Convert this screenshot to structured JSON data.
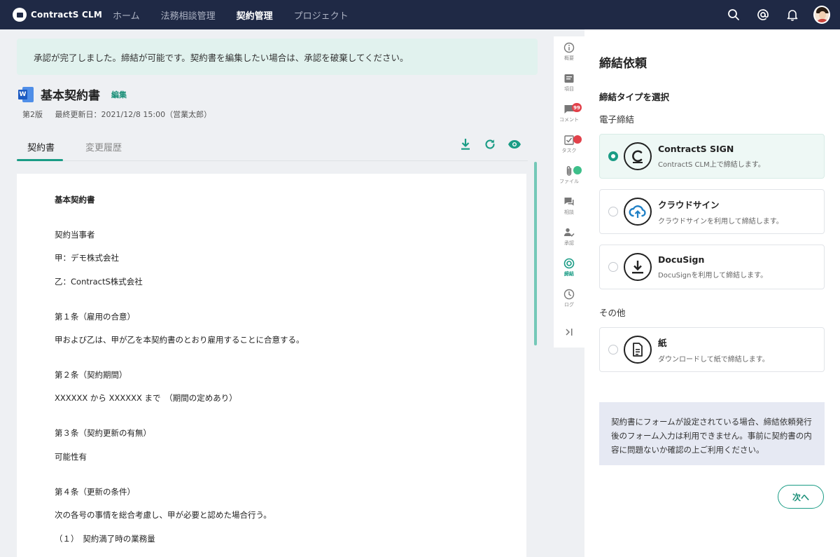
{
  "app": {
    "name": "ContractS CLM"
  },
  "nav": {
    "items": [
      {
        "label": "ホーム",
        "active": false
      },
      {
        "label": "法務相談管理",
        "active": false
      },
      {
        "label": "契約管理",
        "active": true
      },
      {
        "label": "プロジェクト",
        "active": false
      }
    ]
  },
  "alert": {
    "text": "承認が完了しました。締結が可能です。契約書を編集したい場合は、承認を破棄してください。"
  },
  "document": {
    "title": "基本契約書",
    "edit_label": "編集",
    "version": "第2版",
    "updated": "最終更新日：2021/12/8 15:00（営業太郎）",
    "tabs": [
      {
        "label": "契約書",
        "active": true
      },
      {
        "label": "変更履歴",
        "active": false
      }
    ],
    "lines": [
      {
        "text": "基本契約書",
        "bold": true
      },
      {
        "text": "契約当事者",
        "bold": false
      },
      {
        "text": "甲：デモ株式会社",
        "bold": false
      },
      {
        "text": "乙：ContractS株式会社",
        "bold": false
      },
      {
        "text": "第１条（雇用の合意）",
        "bold": false
      },
      {
        "text": "甲および乙は、甲が乙を本契約書のとおり雇用することに合意する。",
        "bold": false
      },
      {
        "text": "第２条（契約期間）",
        "bold": false
      },
      {
        "text": "XXXXXX から XXXXXX まで　（期間の定めあり）",
        "bold": false
      },
      {
        "text": "第３条（契約更新の有無）",
        "bold": false
      },
      {
        "text": "可能性有",
        "bold": false
      },
      {
        "text": "第４条（更新の条件）",
        "bold": false
      },
      {
        "text": "次の各号の事情を総合考慮し、甲が必要と認めた場合行う。",
        "bold": false
      },
      {
        "text": "（１）　契約満了時の業務量",
        "bold": false
      }
    ]
  },
  "rail": {
    "items": [
      {
        "label": "概要",
        "icon": "info-icon"
      },
      {
        "label": "項目",
        "icon": "list-icon"
      },
      {
        "label": "コメント",
        "icon": "comment-icon",
        "badge": "99"
      },
      {
        "label": "タスク",
        "icon": "task-icon",
        "dot_color": "#e2424b"
      },
      {
        "label": "ファイル",
        "icon": "attachment-icon",
        "dot_color": "#3dbf8a"
      },
      {
        "label": "相談",
        "icon": "consult-icon"
      },
      {
        "label": "承認",
        "icon": "approval-icon"
      },
      {
        "label": "締結",
        "icon": "conclude-icon",
        "active": true
      },
      {
        "label": "ログ",
        "icon": "clock-icon"
      },
      {
        "label": "",
        "icon": "collapse-icon"
      }
    ]
  },
  "panel": {
    "title": "締結依頼",
    "section_title": "締結タイプを選択",
    "electronic_label": "電子締結",
    "other_label": "その他",
    "options": [
      {
        "name": "ContractS SIGN",
        "desc": "ContractS CLM上で締結します。",
        "selected": true
      },
      {
        "name": "クラウドサイン",
        "desc": "クラウドサインを利用して締結します。",
        "selected": false
      },
      {
        "name": "DocuSign",
        "desc": "DocuSignを利用して締結します。",
        "selected": false
      },
      {
        "name": "紙",
        "desc": "ダウンロードして紙で締結します。",
        "selected": false
      }
    ],
    "note": "契約書にフォームが設定されている場合、締結依頼発行後のフォーム入力は利用できません。事前に契約書の内容に問題ないか確認の上ご利用ください。",
    "next_label": "次へ"
  },
  "colors": {
    "nav_bg": "#1f2945",
    "accent": "#1a9c85",
    "alert_bg": "#e1f2ee",
    "note_bg": "#e6e9f3"
  }
}
